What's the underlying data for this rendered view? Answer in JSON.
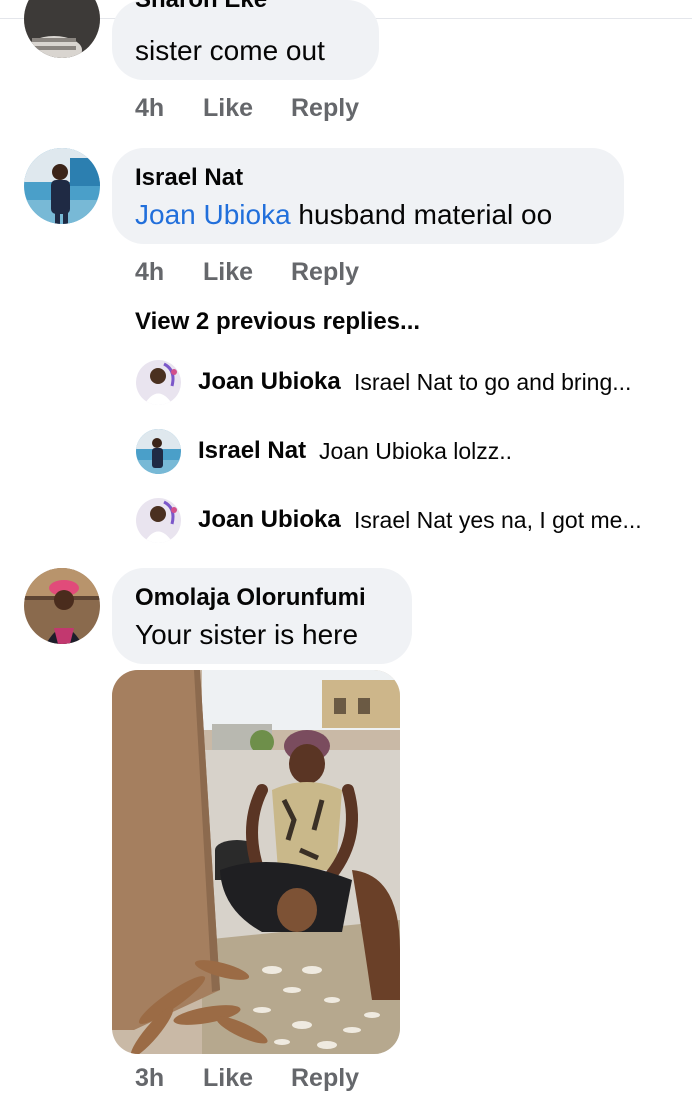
{
  "comments": [
    {
      "author": "Sharon Eke",
      "text": "sister come out",
      "time": "4h",
      "like": "Like",
      "reply": "Reply"
    },
    {
      "author": "Israel Nat",
      "mention": "Joan Ubioka",
      "text": " husband material oo",
      "time": "4h",
      "like": "Like",
      "reply": "Reply",
      "view_replies": "View 2 previous replies...",
      "replies": [
        {
          "author": "Joan Ubioka",
          "text": "Israel Nat to go and bring..."
        },
        {
          "author": "Israel Nat",
          "text": "Joan Ubioka lolzz.."
        },
        {
          "author": "Joan Ubioka",
          "text": "Israel Nat yes na, I got me..."
        }
      ]
    },
    {
      "author": "Omolaja Olorunfumi",
      "text": "Your sister is here",
      "time": "3h",
      "like": "Like",
      "reply": "Reply"
    }
  ],
  "colors": {
    "bubble": "#f0f2f5",
    "mention": "#216fdb",
    "meta": "#65676b"
  }
}
